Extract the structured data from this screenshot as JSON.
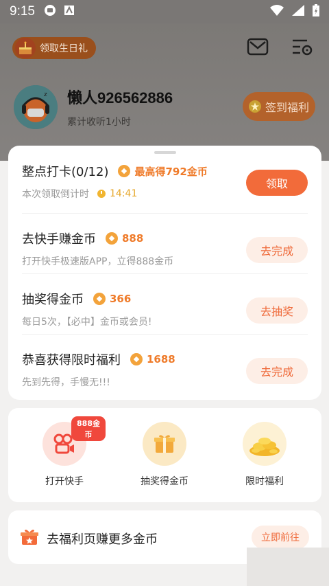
{
  "status": {
    "time": "9:15"
  },
  "header": {
    "birthday_label": "领取生日礼",
    "username": "懒人926562886",
    "listen_time": "累计收听1小时",
    "signin_label": "签到福利"
  },
  "tasks": [
    {
      "title": "整点打卡(0/12)",
      "reward": "最高得792金币",
      "desc": "本次领取倒计时",
      "timer": "14:41",
      "button": "领取"
    },
    {
      "title": "去快手赚金币",
      "reward": "888",
      "desc": "打开快手极速版APP，立得888金币",
      "button": "去完成"
    },
    {
      "title": "抽奖得金币",
      "reward": "366",
      "desc": "每日5次，【必中】金币或会员!",
      "button": "去抽奖"
    },
    {
      "title": "恭喜获得限时福利",
      "reward": "1688",
      "desc": "先到先得，手慢无!!!",
      "button": "去完成"
    }
  ],
  "shortcuts": [
    {
      "label": "打开快手",
      "badge": "888金币"
    },
    {
      "label": "抽奖得金币"
    },
    {
      "label": "限时福利"
    }
  ],
  "promo": {
    "text": "去福利页赚更多金币",
    "button": "立即前往"
  },
  "colors": {
    "accent": "#f26b3a",
    "reward": "#ef7b2a",
    "soft_button_bg": "#fdeee6"
  }
}
